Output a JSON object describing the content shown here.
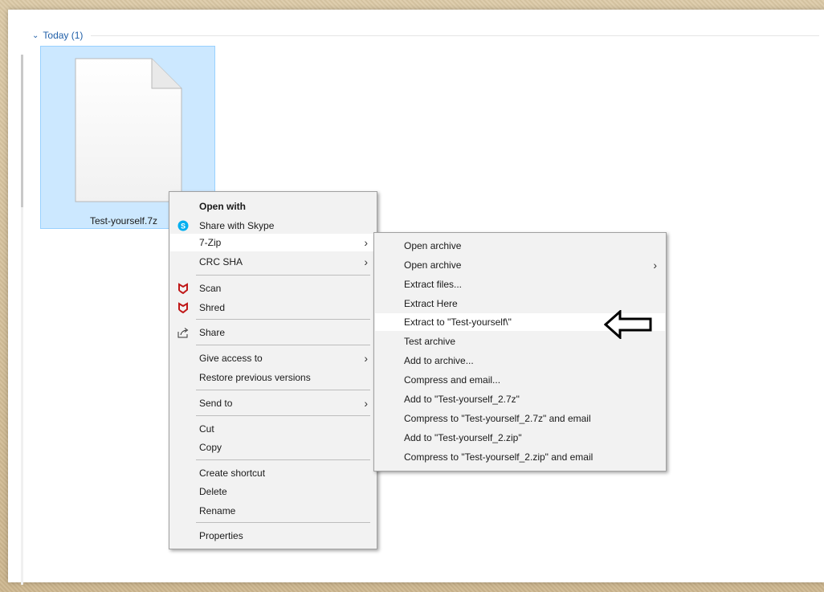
{
  "group": {
    "label": "Today (1)"
  },
  "file": {
    "name": "Test-yourself.7z"
  },
  "context_menu": {
    "items": [
      {
        "label": "Open with"
      },
      {
        "label": "Share with Skype"
      },
      {
        "label": "7-Zip"
      },
      {
        "label": "CRC SHA"
      },
      {
        "label": "Scan"
      },
      {
        "label": "Shred"
      },
      {
        "label": "Share"
      },
      {
        "label": "Give access to"
      },
      {
        "label": "Restore previous versions"
      },
      {
        "label": "Send to"
      },
      {
        "label": "Cut"
      },
      {
        "label": "Copy"
      },
      {
        "label": "Create shortcut"
      },
      {
        "label": "Delete"
      },
      {
        "label": "Rename"
      },
      {
        "label": "Properties"
      }
    ]
  },
  "submenu_7zip": {
    "items": [
      {
        "label": "Open archive"
      },
      {
        "label": "Open archive"
      },
      {
        "label": "Extract files..."
      },
      {
        "label": "Extract Here"
      },
      {
        "label": "Extract to \"Test-yourself\\\""
      },
      {
        "label": "Test archive"
      },
      {
        "label": "Add to archive..."
      },
      {
        "label": "Compress and email..."
      },
      {
        "label": "Add to \"Test-yourself_2.7z\""
      },
      {
        "label": "Compress to \"Test-yourself_2.7z\" and email"
      },
      {
        "label": "Add to \"Test-yourself_2.zip\""
      },
      {
        "label": "Compress to \"Test-yourself_2.zip\" and email"
      }
    ]
  },
  "icons": {
    "skype": "skype-icon",
    "mcafee": "mcafee-icon",
    "share": "share-icon",
    "callout": "left-arrow-callout-icon"
  },
  "colors": {
    "selection": "#cce8ff",
    "group_header": "#1f5fa8",
    "menu_bg": "#f2f2f2",
    "skype": "#00aff0",
    "mcafee": "#c01818"
  }
}
